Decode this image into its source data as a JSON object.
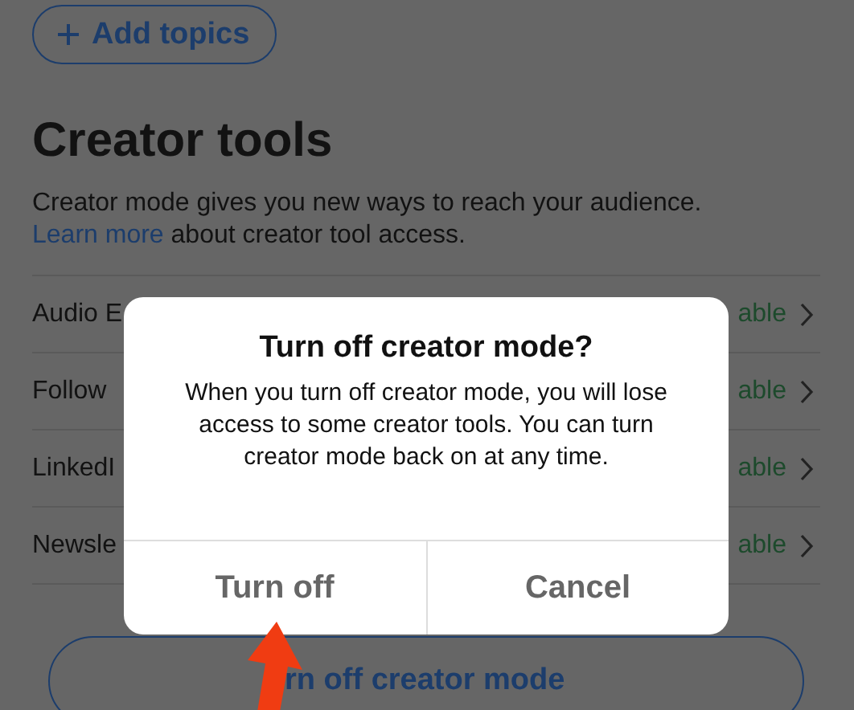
{
  "add_topics_button": {
    "label": "Add topics"
  },
  "section": {
    "title": "Creator tools",
    "description": "Creator mode gives you new ways to reach your audience.",
    "link": "Learn more",
    "description_after": "about creator tool access."
  },
  "tools": [
    {
      "label": "Audio E",
      "status": "able"
    },
    {
      "label": "Follow",
      "status": "able"
    },
    {
      "label": "LinkedI",
      "status": "able"
    },
    {
      "label": "Newsle",
      "status": "able"
    }
  ],
  "dialog": {
    "title": "Turn off creator mode?",
    "message": "When you turn off creator mode, you will lose access to some creator tools. You can turn creator mode back on at any time.",
    "buttons": [
      {
        "label": "Turn off"
      },
      {
        "label": "Cancel"
      }
    ]
  },
  "bottom_button": {
    "label": "rn off creator mode"
  }
}
